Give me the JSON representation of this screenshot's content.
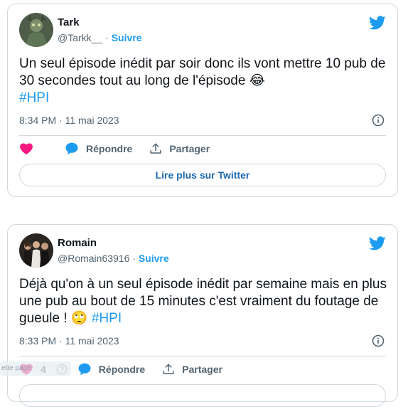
{
  "tweets": [
    {
      "author": "Tark",
      "handle": "@Tarkk__",
      "dot": "·",
      "follow_label": "Suivre",
      "text": "Un seul épisode inédit par soir donc ils vont mettre 10 pub de 30 secondes tout au long de l'épisode",
      "emoji": "😂",
      "hashtag": "#HPI",
      "timestamp": "8:34 PM · 11 mai 2023",
      "reply_label": "Répondre",
      "share_label": "Partager",
      "read_more_label": "Lire plus sur Twitter"
    },
    {
      "author": "Romain",
      "handle": "@Romain63916",
      "dot": "·",
      "follow_label": "Suivre",
      "text": "Déjà qu'on à un seul épisode inédit par semaine mais en plus une pub au bout de 15 minutes c'est vraiment du foutage de gueule !",
      "emoji": "🙄",
      "hashtag": "#HPI",
      "timestamp": "8:33 PM · 11 mai 2023",
      "like_count": "4",
      "reply_label": "Répondre",
      "share_label": "Partager"
    }
  ],
  "overlay": {
    "ghost_text": "ette page"
  },
  "colors": {
    "twitter_blue": "#1d9bf0",
    "like_pink": "#f91880",
    "border": "#cfd9de",
    "muted": "#536471"
  }
}
